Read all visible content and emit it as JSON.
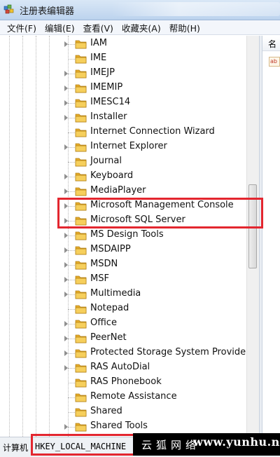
{
  "window": {
    "title": "注册表编辑器"
  },
  "menu": [
    "文件(F)",
    "编辑(E)",
    "查看(V)",
    "收藏夹(A)",
    "帮助(H)"
  ],
  "tree": {
    "items": [
      {
        "label": "IAM",
        "expandable": true
      },
      {
        "label": "IME",
        "expandable": false
      },
      {
        "label": "IMEJP",
        "expandable": true
      },
      {
        "label": "IMEMIP",
        "expandable": true
      },
      {
        "label": "IMESC14",
        "expandable": true
      },
      {
        "label": "Installer",
        "expandable": true
      },
      {
        "label": "Internet Connection Wizard",
        "expandable": false
      },
      {
        "label": "Internet Explorer",
        "expandable": true
      },
      {
        "label": "Journal",
        "expandable": false
      },
      {
        "label": "Keyboard",
        "expandable": true
      },
      {
        "label": "MediaPlayer",
        "expandable": true
      },
      {
        "label": "Microsoft Management Console",
        "expandable": true
      },
      {
        "label": "Microsoft SQL Server",
        "expandable": true
      },
      {
        "label": "MS Design Tools",
        "expandable": true
      },
      {
        "label": "MSDAIPP",
        "expandable": true
      },
      {
        "label": "MSDN",
        "expandable": true
      },
      {
        "label": "MSF",
        "expandable": true
      },
      {
        "label": "Multimedia",
        "expandable": true
      },
      {
        "label": "Notepad",
        "expandable": false
      },
      {
        "label": "Office",
        "expandable": true
      },
      {
        "label": "PeerNet",
        "expandable": true
      },
      {
        "label": "Protected Storage System Provider",
        "expandable": true
      },
      {
        "label": "RAS AutoDial",
        "expandable": true
      },
      {
        "label": "RAS Phonebook",
        "expandable": false
      },
      {
        "label": "Remote Assistance",
        "expandable": false
      },
      {
        "label": "Shared",
        "expandable": false
      },
      {
        "label": "Shared Tools",
        "expandable": true
      }
    ]
  },
  "right_pane": {
    "header": "名",
    "value_icon_text": "ab"
  },
  "status": {
    "label": "计算机",
    "path": "HKEY_LOCAL_MACHINE"
  },
  "watermark": {
    "text_cn": "云狐网络",
    "url": "www.yunhu.net"
  },
  "colors": {
    "highlight": "#e3262f",
    "folder": "#f2c14e",
    "titlebar": "#c9dcf2"
  }
}
